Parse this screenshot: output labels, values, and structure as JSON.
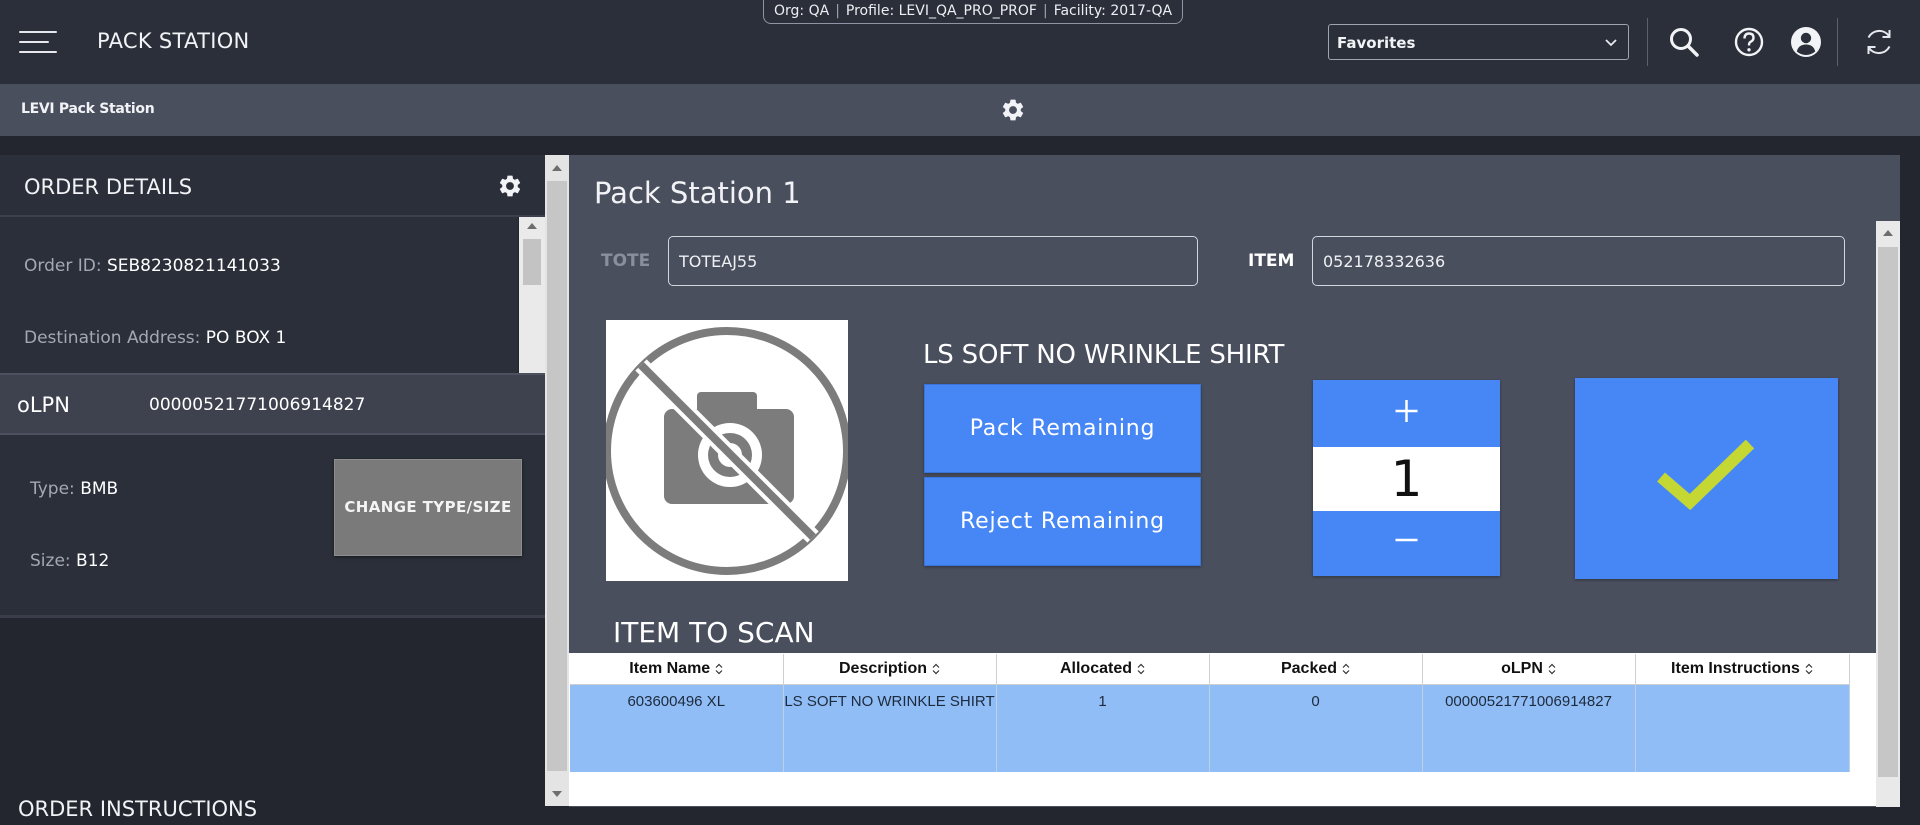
{
  "header": {
    "app_title": "PACK STATION",
    "context": {
      "org": "Org: QA",
      "profile": "Profile: LEVI_QA_PRO_PROF",
      "facility": "Facility: 2017-QA"
    },
    "favorites": {
      "value": "Favorites"
    },
    "icons": [
      "menu-icon",
      "search-icon",
      "help-icon",
      "user-account-icon",
      "refresh-icon"
    ]
  },
  "subbar": {
    "title": "LEVI Pack Station",
    "icon": "gear-icon"
  },
  "order_details": {
    "title": "ORDER DETAILS",
    "order_id_label": "Order ID:",
    "order_id": "SEB8230821141033",
    "destination_label": "Destination Address:",
    "destination": "PO BOX 1"
  },
  "olpn": {
    "label": "oLPN",
    "value": "00000521771006914827",
    "type_label": "Type:",
    "type": "BMB",
    "size_label": "Size:",
    "size": "B12",
    "change_button": "CHANGE TYPE/SIZE"
  },
  "order_instructions": {
    "title": "ORDER INSTRUCTIONS"
  },
  "pack_station": {
    "title": "Pack Station 1",
    "tote_label": "TOTE",
    "tote_value": "TOTEAJ55",
    "item_label": "ITEM",
    "item_value": "052178332636",
    "item_description": "LS SOFT NO WRINKLE SHIRT",
    "pack_remaining": "Pack Remaining",
    "reject_remaining": "Reject Remaining",
    "quantity": "1",
    "image_icon": "no-image-camera-icon",
    "confirm_icon": "checkmark-icon"
  },
  "item_to_scan": {
    "title": "ITEM TO SCAN",
    "columns": [
      "Item Name",
      "Description",
      "Allocated",
      "Packed",
      "oLPN",
      "Item Instructions"
    ],
    "rows": [
      [
        "603600496 XL",
        "LS SOFT NO WRINKLE SHIRT",
        "1",
        "0",
        "00000521771006914827",
        ""
      ]
    ]
  },
  "colors": {
    "header_bg": "#2b2f39",
    "subbar_bg": "#4a4f5e",
    "accent_blue": "#4787f5",
    "selected_row": "#90bdf5",
    "check_green": "#c5d733"
  }
}
